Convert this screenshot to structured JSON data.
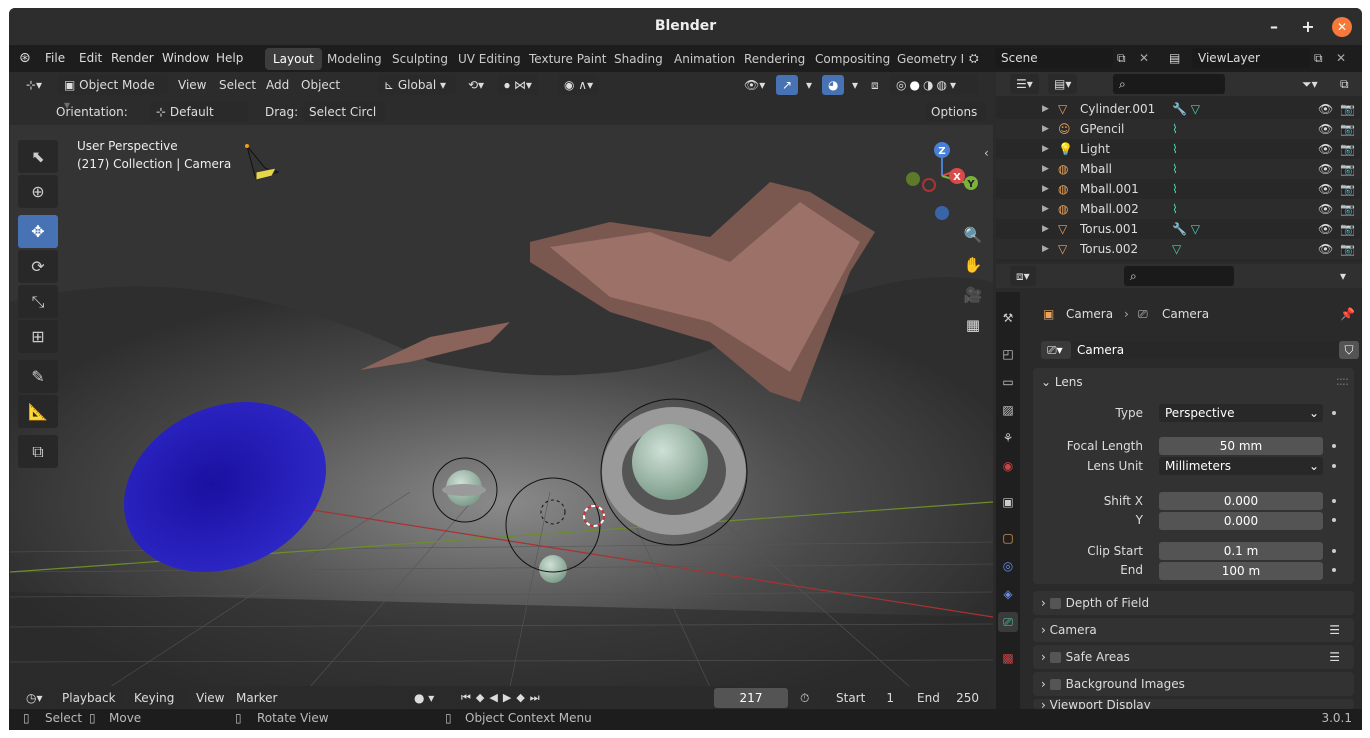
{
  "window": {
    "title": "Blender",
    "minimize": "–",
    "maximize": "+",
    "close": "✕"
  },
  "menu": [
    "File",
    "Edit",
    "Render",
    "Window",
    "Help"
  ],
  "workspaces": [
    "Layout",
    "Modeling",
    "Sculpting",
    "UV Editing",
    "Texture Paint",
    "Shading",
    "Animation",
    "Rendering",
    "Compositing",
    "Geometry N"
  ],
  "scene": {
    "scene_name": "Scene",
    "view_layer": "ViewLayer"
  },
  "viewport": {
    "mode": "Object Mode",
    "menus": [
      "View",
      "Select",
      "Add",
      "Object"
    ],
    "transform": "Global",
    "orientation_label": "Orientation:",
    "orientation_value": "Default",
    "drag_label": "Drag:",
    "drag_value": "Select Circl",
    "options": "Options",
    "overlay_line1": "User Perspective",
    "overlay_line2": "(217) Collection | Camera",
    "gizmo": {
      "z": "Z",
      "x": "X",
      "y": "Y"
    }
  },
  "timeline": {
    "menus": [
      "Playback",
      "Keying",
      "View",
      "Marker"
    ],
    "current_frame": "217",
    "start_label": "Start",
    "start_value": "1",
    "end_label": "End",
    "end_value": "250"
  },
  "status": {
    "select": "Select",
    "move": "Move",
    "rotate": "Rotate View",
    "context": "Object Context Menu",
    "version": "3.0.1"
  },
  "outliner": {
    "items": [
      {
        "name": "Cylinder.001",
        "color": "#e8a35c"
      },
      {
        "name": "GPencil",
        "color": "#e8a35c"
      },
      {
        "name": "Light",
        "color": "#e8a35c"
      },
      {
        "name": "Mball",
        "color": "#e8a35c"
      },
      {
        "name": "Mball.001",
        "color": "#e8a35c"
      },
      {
        "name": "Mball.002",
        "color": "#e8a35c"
      },
      {
        "name": "Torus.001",
        "color": "#e8a35c"
      },
      {
        "name": "Torus.002",
        "color": "#e8a35c"
      }
    ]
  },
  "properties": {
    "breadcrumb_object": "Camera",
    "breadcrumb_data": "Camera",
    "datablock": "Camera",
    "lens_panel": "Lens",
    "type_label": "Type",
    "type_value": "Perspective",
    "focal_label": "Focal Length",
    "focal_value": "50 mm",
    "lens_unit_label": "Lens Unit",
    "lens_unit_value": "Millimeters",
    "shiftx_label": "Shift X",
    "shiftx_value": "0.000",
    "shifty_label": "Y",
    "shifty_value": "0.000",
    "clipstart_label": "Clip Start",
    "clipstart_value": "0.1 m",
    "clipend_label": "End",
    "clipend_value": "100 m",
    "subpanels": [
      "Depth of Field",
      "Camera",
      "Safe Areas",
      "Background Images",
      "Viewport Display"
    ]
  },
  "colors": {
    "accent": "#4772b3",
    "close": "#f5793a"
  }
}
